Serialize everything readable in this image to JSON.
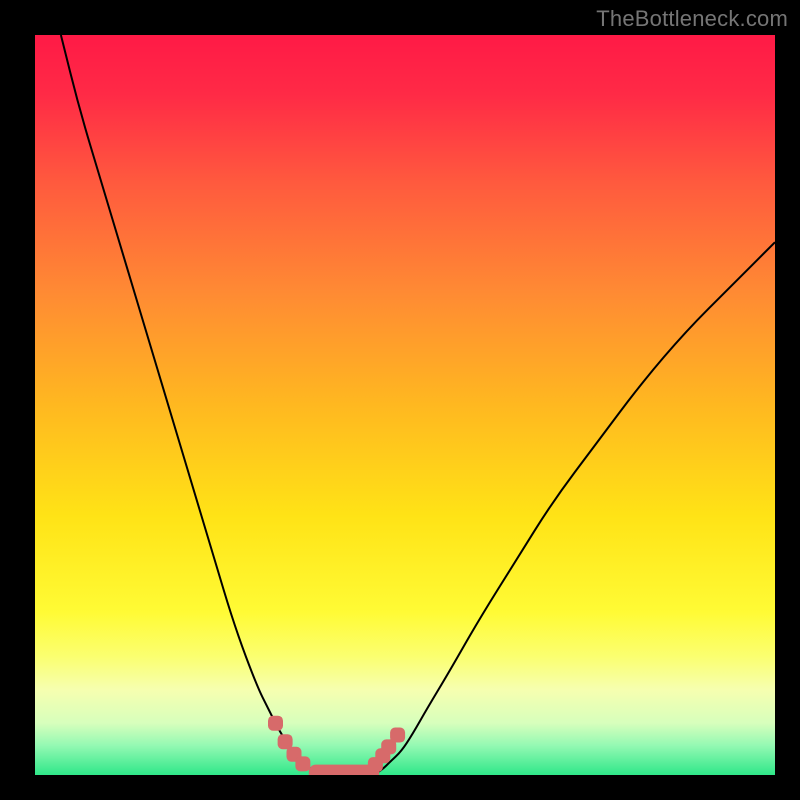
{
  "watermark": "TheBottleneck.com",
  "colors": {
    "gradient_stops": [
      {
        "offset": 0.0,
        "color": "#ff1a46"
      },
      {
        "offset": 0.08,
        "color": "#ff2a46"
      },
      {
        "offset": 0.2,
        "color": "#ff5a3e"
      },
      {
        "offset": 0.35,
        "color": "#ff8b33"
      },
      {
        "offset": 0.5,
        "color": "#ffb820"
      },
      {
        "offset": 0.65,
        "color": "#ffe316"
      },
      {
        "offset": 0.78,
        "color": "#fffb35"
      },
      {
        "offset": 0.84,
        "color": "#fbff70"
      },
      {
        "offset": 0.885,
        "color": "#f6ffb0"
      },
      {
        "offset": 0.93,
        "color": "#d7ffbc"
      },
      {
        "offset": 0.96,
        "color": "#94f9b3"
      },
      {
        "offset": 1.0,
        "color": "#2fe789"
      }
    ],
    "curve": "#000000",
    "markers": "#d76a6a",
    "background": "#000000"
  },
  "chart_data": {
    "type": "line",
    "title": "",
    "xlabel": "",
    "ylabel": "",
    "xlim": [
      0,
      100
    ],
    "ylim": [
      0,
      100
    ],
    "grid": false,
    "series": [
      {
        "name": "left-curve",
        "x": [
          3.5,
          6,
          9,
          12,
          15,
          18,
          21,
          24,
          27,
          30,
          31.5,
          33,
          34.3,
          35.5,
          36.5,
          37.2,
          38
        ],
        "values": [
          100,
          90,
          80,
          70,
          60,
          50,
          40,
          30,
          20,
          12,
          9,
          6,
          4,
          2.6,
          1.6,
          0.8,
          0.2
        ]
      },
      {
        "name": "right-curve",
        "x": [
          46,
          47,
          48,
          49.5,
          51,
          53,
          56,
          60,
          65,
          70,
          76,
          82,
          88,
          94,
          100
        ],
        "values": [
          0.2,
          0.8,
          1.8,
          3.2,
          5.5,
          9,
          14,
          21,
          29,
          37,
          45,
          53,
          60,
          66,
          72
        ]
      }
    ],
    "markers": [
      {
        "x": 32.5,
        "y": 7.0
      },
      {
        "x": 33.8,
        "y": 4.5
      },
      {
        "x": 35.0,
        "y": 2.8
      },
      {
        "x": 36.2,
        "y": 1.5
      },
      {
        "x": 46.0,
        "y": 1.4
      },
      {
        "x": 47.0,
        "y": 2.6
      },
      {
        "x": 47.8,
        "y": 3.8
      },
      {
        "x": 49.0,
        "y": 5.4
      }
    ],
    "baseline_segment": {
      "x_start": 37.0,
      "x_end": 46.5,
      "y": 0.3,
      "thickness": 2.2
    }
  }
}
